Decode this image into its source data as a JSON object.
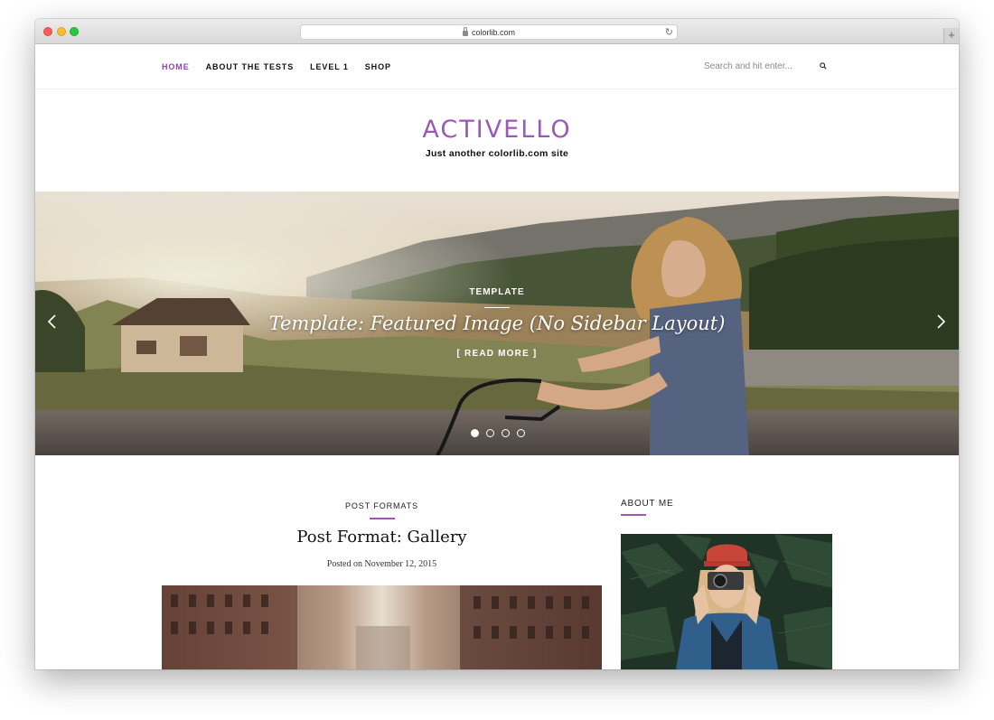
{
  "browser": {
    "url": "colorlib.com",
    "new_tab": "+"
  },
  "nav": {
    "links": [
      "HOME",
      "ABOUT THE TESTS",
      "LEVEL 1",
      "SHOP"
    ],
    "active_index": 0,
    "search_placeholder": "Search and hit enter..."
  },
  "site": {
    "title": "ACTIVELLO",
    "tagline": "Just another colorlib.com site"
  },
  "slider": {
    "category": "TEMPLATE",
    "title": "Template: Featured Image (No Sidebar Layout)",
    "read_more": "[ READ MORE ]",
    "slide_count": 4,
    "active_slide": 1
  },
  "post": {
    "category": "POST FORMATS",
    "title": "Post Format: Gallery",
    "date": "Posted on November 12, 2015"
  },
  "sidebar": {
    "heading": "ABOUT ME"
  },
  "colors": {
    "accent": "#9b59b6",
    "nav_active": "#8e44ad",
    "text": "#111111"
  }
}
